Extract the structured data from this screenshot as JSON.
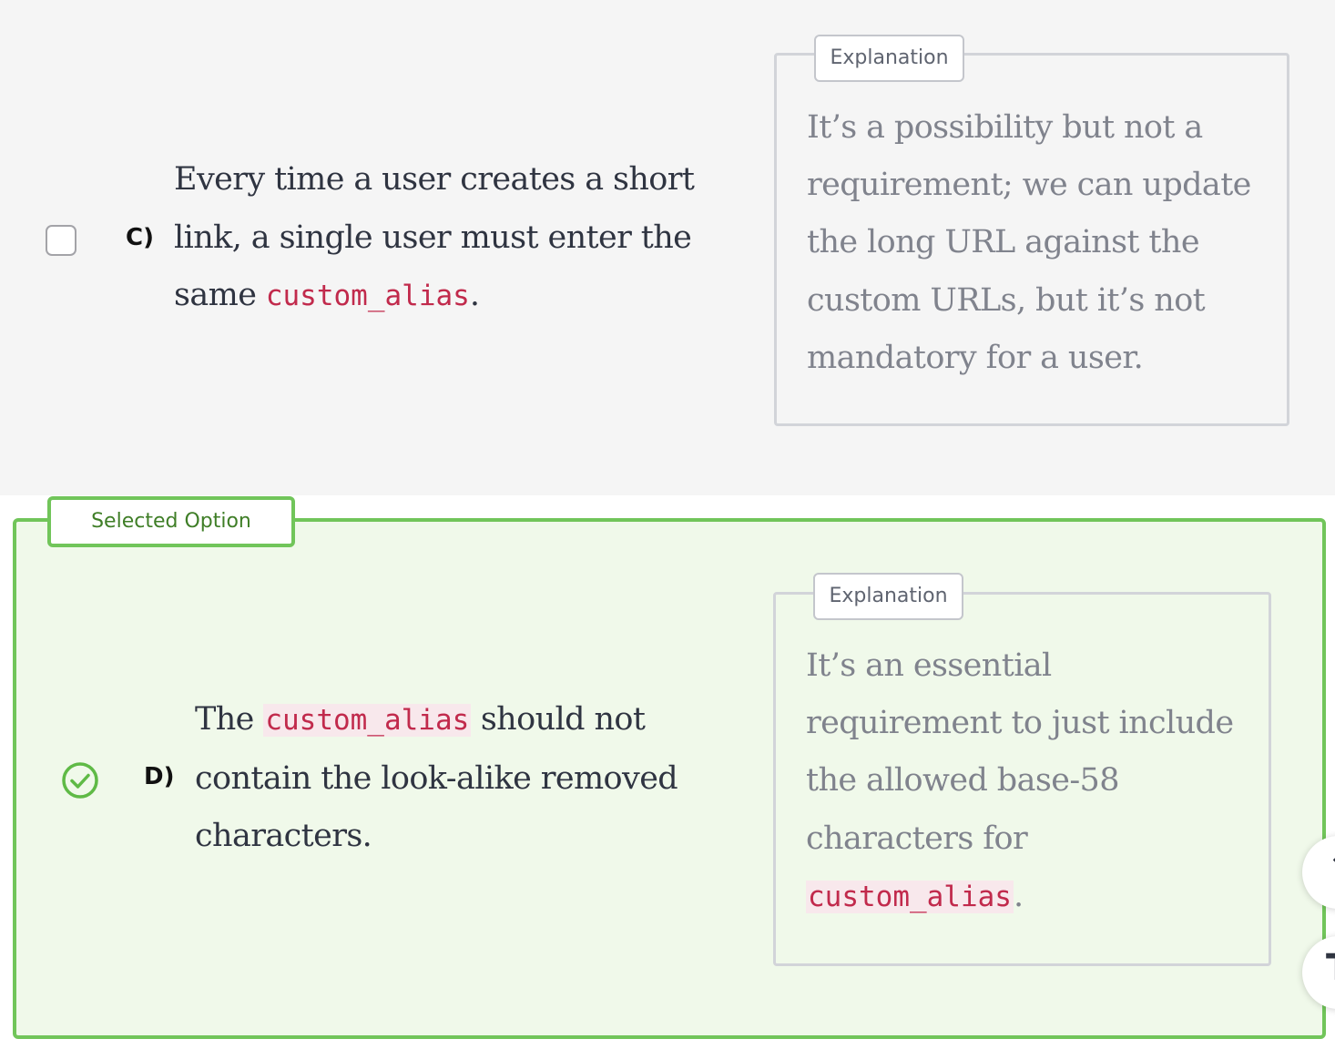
{
  "option_c": {
    "letter": "C)",
    "text_before": "Every time a user creates a short link, a single user must enter the same ",
    "code": "custom_alias",
    "text_after": ".",
    "checked": false,
    "explanation_label": "Explanation",
    "explanation_text": "It’s a possibility but not a requirement; we can update the long URL against the custom URLs, but it’s not mandatory for a user."
  },
  "option_d": {
    "selected_label": "Selected Option",
    "letter": "D)",
    "text_before": "The ",
    "code": "custom_alias",
    "text_after": " should not contain the look-alike removed characters.",
    "checked": true,
    "explanation_label": "Explanation",
    "explanation_text_before": "It’s an essential requirement to just include the allowed base-58 characters for ",
    "explanation_code": "custom_alias",
    "explanation_text_after": "."
  },
  "colors": {
    "selected_border": "#71c55a",
    "selected_background": "#f0f9ea",
    "code_text": "#c12a4c",
    "explanation_text": "#80838d"
  },
  "icons": {
    "option_c_checkbox": "empty-checkbox-icon",
    "option_d_indicator": "check-circle-icon",
    "side_controls": [
      "arrow-up-icon",
      "text-icon"
    ]
  }
}
